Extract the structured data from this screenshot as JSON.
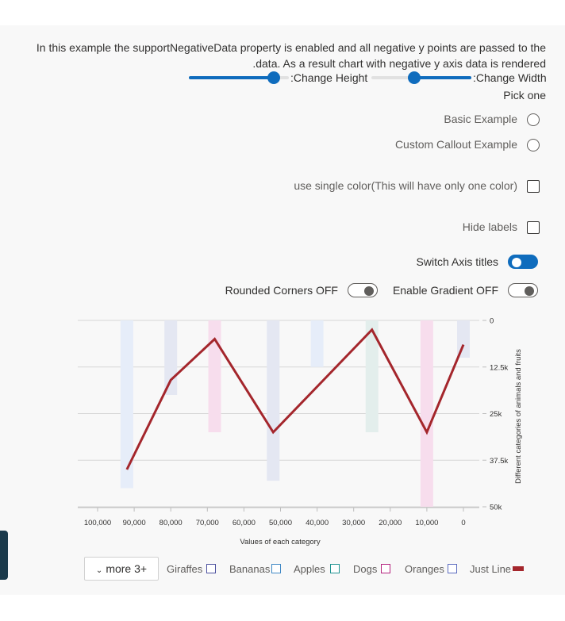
{
  "description": "In this example the supportNegativeData property is enabled and all negative y points are passed to the .data. As a result chart with negative y axis data is rendered",
  "description_line1": "In this example the supportNegativeData property is enabled and all negative y points are passed to the",
  "description_line2": ".data. As a result chart with negative y axis data is rendered",
  "controls": {
    "change_height_label": ":Change Height",
    "change_width_label": ":Change Width",
    "height_level": 0.85,
    "width_level": 0.43,
    "pick_one_label": "Pick one",
    "basic_example_label": "Basic Example",
    "custom_callout_label": "Custom Callout Example",
    "single_color_label": "use single color(This will have only one color)",
    "hide_labels_label": "Hide labels",
    "switch_axis_titles_label": "Switch Axis titles",
    "switch_axis_titles_on": true,
    "rounded_corners_label": "Rounded Corners OFF",
    "rounded_corners_on": false,
    "enable_gradient_label": "Enable Gradient OFF",
    "enable_gradient_on": false
  },
  "chart_data": {
    "type": "bar",
    "xlabel": "Values of each category",
    "ylabel": "Different categories of animals and fruits",
    "x_ticks": [
      "100,000",
      "90,000",
      "80,000",
      "70,000",
      "60,000",
      "50,000",
      "40,000",
      "30,000",
      "20,000",
      "10,000",
      "0"
    ],
    "x_range": [
      100000,
      0
    ],
    "y_ticks": [
      "0",
      "12.5k",
      "25k",
      "37.5k",
      "50k"
    ],
    "y_range": [
      0,
      50000
    ],
    "grid": true,
    "bars": [
      {
        "x": 92000,
        "y": 45000,
        "color": "#e6edf9"
      },
      {
        "x": 80000,
        "y": 20000,
        "color": "#e4e7f2"
      },
      {
        "x": 68000,
        "y": 30000,
        "color": "#f7dded"
      },
      {
        "x": 52000,
        "y": 43000,
        "color": "#e4e7f2"
      },
      {
        "x": 40000,
        "y": 12500,
        "color": "#e6edf9"
      },
      {
        "x": 25000,
        "y": 30000,
        "color": "#e3eeec"
      },
      {
        "x": 10000,
        "y": 50000,
        "color": "#f7dded"
      },
      {
        "x": 0,
        "y": 10000,
        "color": "#e4e7f2"
      }
    ],
    "line": {
      "name": "Just Line",
      "color": "#a4262c",
      "points": [
        {
          "x": 92000,
          "y": 40000
        },
        {
          "x": 80000,
          "y": 16000
        },
        {
          "x": 68000,
          "y": 5000
        },
        {
          "x": 52000,
          "y": 30000
        },
        {
          "x": 25000,
          "y": 2500
        },
        {
          "x": 10000,
          "y": 30000
        },
        {
          "x": 0,
          "y": 6500
        }
      ]
    }
  },
  "legend": {
    "more_label": "more 3+",
    "items": [
      {
        "label": "Giraffes",
        "color": "#4b4f9e",
        "filled": false
      },
      {
        "label": "Bananas",
        "color": "#3f88c5",
        "filled": false
      },
      {
        "label": "Apples",
        "color": "#1f9391",
        "filled": false
      },
      {
        "label": "Dogs",
        "color": "#b4237e",
        "filled": false
      },
      {
        "label": "Oranges",
        "color": "#5c6cbf",
        "filled": false
      },
      {
        "label": "Just Line",
        "color": "#a4262c",
        "filled": true
      }
    ]
  }
}
